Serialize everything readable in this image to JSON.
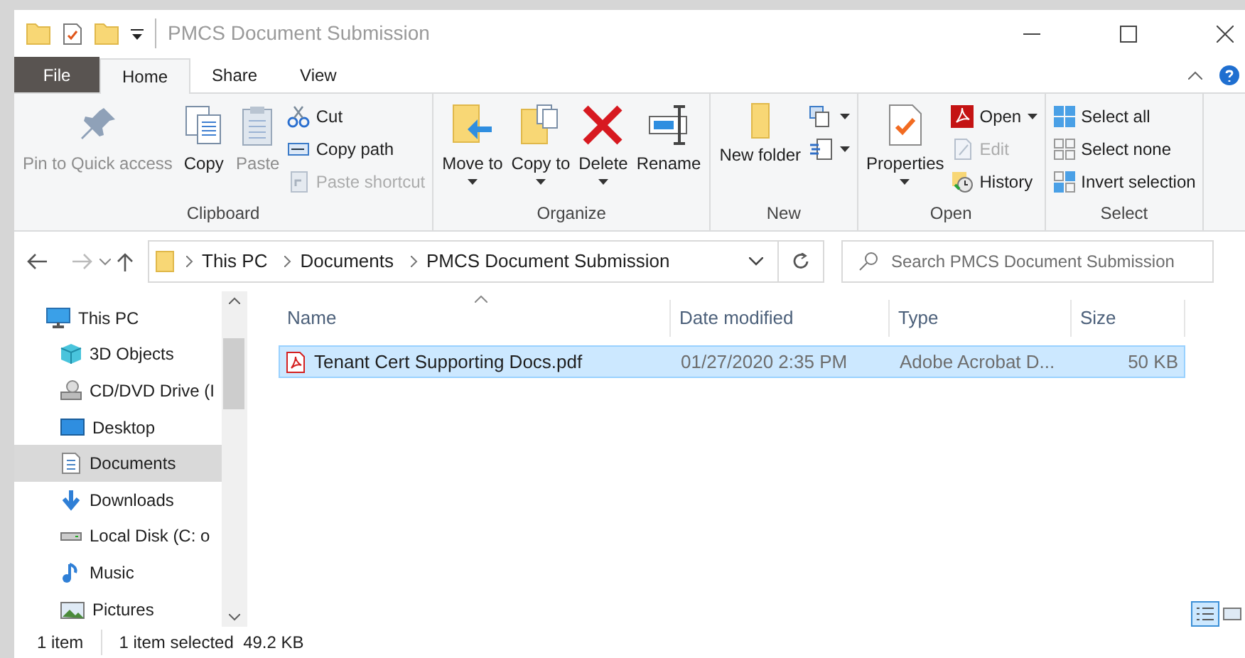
{
  "window": {
    "title": "PMCS Document Submission"
  },
  "ribbon_tabs": [
    {
      "label": "File",
      "kind": "file",
      "selected": false
    },
    {
      "label": "Home",
      "kind": "tab",
      "selected": true
    },
    {
      "label": "Share",
      "kind": "tab",
      "selected": false
    },
    {
      "label": "View",
      "kind": "tab",
      "selected": false
    }
  ],
  "ribbon_groups": [
    {
      "label": "Clipboard",
      "items": [
        {
          "kind": "large",
          "label": "Pin to Quick access",
          "disabled": true
        },
        {
          "kind": "large",
          "label": "Copy",
          "disabled": false
        },
        {
          "kind": "large",
          "label": "Paste",
          "disabled": true
        },
        {
          "kind": "stack",
          "items": [
            {
              "label": "Cut",
              "disabled": false
            },
            {
              "label": "Copy path",
              "disabled": false
            },
            {
              "label": "Paste shortcut",
              "disabled": true
            }
          ]
        }
      ]
    },
    {
      "label": "Organize",
      "items": [
        {
          "kind": "large",
          "label": "Move to",
          "disabled": false
        },
        {
          "kind": "large",
          "label": "Copy to",
          "disabled": false
        },
        {
          "kind": "large",
          "label": "Delete",
          "disabled": false
        },
        {
          "kind": "large",
          "label": "Rename",
          "disabled": false
        }
      ]
    },
    {
      "label": "New",
      "items": [
        {
          "kind": "large",
          "label": "New folder",
          "disabled": false
        },
        {
          "kind": "stack",
          "items": [
            {
              "disabled": false
            },
            {
              "disabled": false
            }
          ]
        }
      ]
    },
    {
      "label": "Open",
      "items": [
        {
          "kind": "large",
          "label": "Properties",
          "disabled": false
        },
        {
          "kind": "stack",
          "items": [
            {
              "label": "Open",
              "disabled": false
            },
            {
              "label": "Edit",
              "disabled": true
            },
            {
              "label": "History",
              "disabled": false
            }
          ]
        }
      ]
    },
    {
      "label": "Select",
      "items": [
        {
          "kind": "stack",
          "items": [
            {
              "label": "Select all",
              "disabled": false
            },
            {
              "label": "Select none",
              "disabled": false
            },
            {
              "label": "Invert selection",
              "disabled": false
            }
          ]
        }
      ]
    }
  ],
  "address_bar": {
    "crumbs": [
      "This PC",
      "Documents",
      "PMCS Document Submission"
    ]
  },
  "search": {
    "placeholder": "Search PMCS Document Submission"
  },
  "navigation_pane": [
    {
      "label": "This PC",
      "selected": false,
      "children": [
        {
          "label": "3D Objects",
          "selected": false
        },
        {
          "label": "CD/DVD Drive (I",
          "selected": false
        },
        {
          "label": "Desktop",
          "selected": false
        },
        {
          "label": "Documents",
          "selected": true
        },
        {
          "label": "Downloads",
          "selected": false
        },
        {
          "label": "Local Disk (C: o",
          "selected": false
        },
        {
          "label": "Music",
          "selected": false
        },
        {
          "label": "Pictures",
          "selected": false
        }
      ]
    }
  ],
  "file_list": {
    "columns": [
      "Name",
      "Date modified",
      "Type",
      "Size"
    ],
    "rows": [
      {
        "name": "Tenant Cert Supporting Docs.pdf",
        "date_modified": "01/27/2020 2:35 PM",
        "type": "Adobe Acrobat D...",
        "size": "50 KB",
        "selected": true
      }
    ]
  },
  "status_bar": {
    "item_count": "1 item",
    "selection": "1 item selected  49.2 KB"
  }
}
